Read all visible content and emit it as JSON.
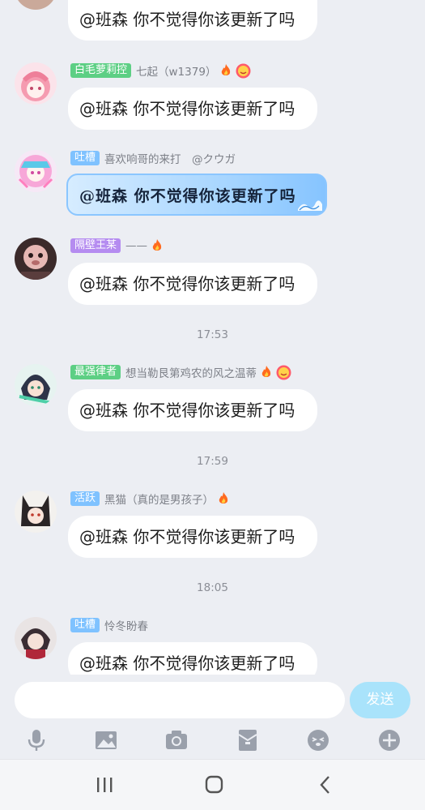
{
  "messages": [
    {
      "badge": "",
      "badge_color": "",
      "nick": "",
      "text": "@班森 你不觉得你该更新了吗",
      "avatar": "avatar-partial"
    },
    {
      "badge": "白毛萝莉控",
      "badge_color": "#5dcf84",
      "nick": "七起（w1379）",
      "text": "@班森 你不觉得你该更新了吗",
      "avatar": "avatar-pink-anime"
    },
    {
      "badge": "吐槽",
      "badge_color": "#7fc2ff",
      "nick": "喜欢响哥的来打　@クウガ",
      "text": "@班森 你不觉得你该更新了吗",
      "avatar": "avatar-colorful-anime"
    },
    {
      "badge": "隔壁王某",
      "badge_color": "#b58cf0",
      "nick": "——",
      "text": "@班森 你不觉得你该更新了吗",
      "avatar": "avatar-photo"
    },
    {
      "badge": "最强律者",
      "badge_color": "#5dcf84",
      "nick": "想当勒艮第鸡农的风之温蒂",
      "text": "@班森 你不觉得你该更新了吗",
      "avatar": "avatar-green-anime"
    },
    {
      "badge": "活跃",
      "badge_color": "#7fc2ff",
      "nick": "黑猫（真的是男孩子）",
      "text": "@班森 你不觉得你该更新了吗",
      "avatar": "avatar-catgirl"
    },
    {
      "badge": "吐槽",
      "badge_color": "#7fc2ff",
      "nick": "怜冬盼春",
      "text": "@班森 你不觉得你该更新了吗",
      "avatar": "avatar-dark-anime"
    }
  ],
  "timestamps": [
    "17:53",
    "17:59",
    "18:05"
  ],
  "input": {
    "placeholder": "",
    "send_label": "发送"
  },
  "toolbar": [
    "microphone-icon",
    "image-icon",
    "camera-icon",
    "red-packet-icon",
    "emoji-icon",
    "plus-icon"
  ],
  "navbar": [
    "recent-apps-icon",
    "home-icon",
    "back-icon"
  ],
  "colors": {
    "background": "#eceef3",
    "send_button": "#a9e3fb",
    "bubble": "#ffffff",
    "timestamp": "#8b8e96"
  }
}
